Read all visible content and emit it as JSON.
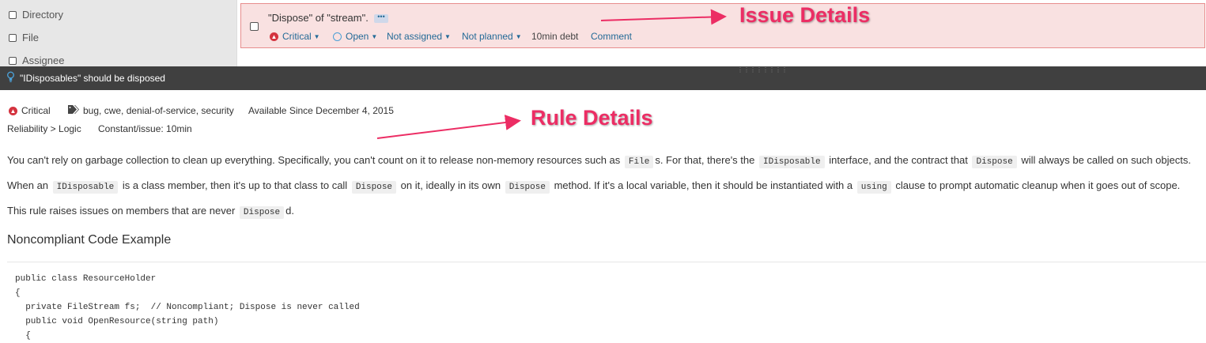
{
  "sidebar": {
    "facets": [
      {
        "label": "Directory"
      },
      {
        "label": "File"
      },
      {
        "label": "Assignee"
      }
    ]
  },
  "issue": {
    "message": "\"Dispose\" of \"stream\".",
    "more_label": "•••",
    "severity": "Critical",
    "status": "Open",
    "assignee": "Not assigned",
    "plan": "Not planned",
    "debt": "10min debt",
    "comment": "Comment"
  },
  "annotations": {
    "issue_details": "Issue Details",
    "rule_details": "Rule Details",
    "color": "#ec2d64"
  },
  "rule": {
    "title": "\"IDisposables\" should be disposed",
    "severity": "Critical",
    "tags": "bug, cwe, denial-of-service, security",
    "available_since": "Available Since December 4, 2015",
    "category": "Reliability > Logic",
    "constant": "Constant/issue: 10min",
    "p1": {
      "a": "You can't rely on garbage collection to clean up everything. Specifically, you can't count on it to release non-memory resources such as",
      "c1": "File",
      "b": "s. For that, there's the",
      "c2": "IDisposable",
      "c": "interface, and the contract that",
      "c3": "Dispose",
      "d": "will always be called on such objects."
    },
    "p2": {
      "a": "When an",
      "c1": "IDisposable",
      "b": "is a class member, then it's up to that class to call",
      "c2": "Dispose",
      "c": "on it, ideally in its own",
      "c3": "Dispose",
      "d": "method. If it's a local variable, then it should be instantiated with a",
      "c4": "using",
      "e": "clause to prompt automatic cleanup when it goes out of scope."
    },
    "p3": {
      "a": "This rule raises issues on members that are never",
      "c1": "Dispose",
      "b": "d."
    },
    "noncompliant_heading": "Noncompliant Code Example",
    "code": "public class ResourceHolder\n{\n  private FileStream fs;  // Noncompliant; Dispose is never called\n  public void OpenResource(string path)\n  {"
  },
  "colors": {
    "issue_bg": "#f9e1e1",
    "issue_border": "#e78d8d",
    "link": "#236a97",
    "critical": "#d4333f",
    "rule_bar": "#404040"
  }
}
